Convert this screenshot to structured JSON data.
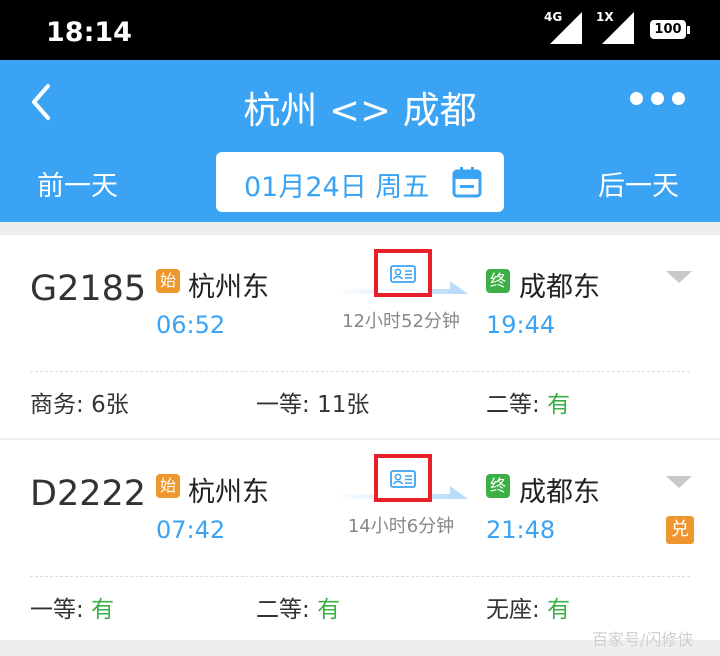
{
  "status_bar": {
    "time": "18:14",
    "network_1": "4G",
    "network_2": "1X",
    "battery": "100"
  },
  "header": {
    "title": "杭州 <> 成都",
    "prev_day": "前一天",
    "next_day": "后一天",
    "date": "01月24日 周五",
    "back_icon": "chevron-left-icon",
    "more_icon": "more-dots-icon",
    "calendar_icon": "calendar-icon"
  },
  "trains": [
    {
      "number": "G2185",
      "start_badge": "始",
      "from": "杭州东",
      "depart": "06:52",
      "duration": "12小时52分钟",
      "end_badge": "终",
      "to": "成都东",
      "arrive": "19:44",
      "seats": [
        {
          "label": "商务:",
          "value": "6张"
        },
        {
          "label": "一等:",
          "value": "11张"
        },
        {
          "label": "二等:",
          "value": "有"
        }
      ]
    },
    {
      "number": "D2222",
      "start_badge": "始",
      "from": "杭州东",
      "depart": "07:42",
      "duration": "14小时6分钟",
      "end_badge": "终",
      "to": "成都东",
      "arrive": "21:48",
      "exchange_badge": "兑",
      "seats": [
        {
          "label": "一等:",
          "value": "有"
        },
        {
          "label": "二等:",
          "value": "有"
        },
        {
          "label": "无座:",
          "value": "有"
        }
      ]
    }
  ],
  "colors": {
    "primary": "#3aa3f4",
    "available": "#3cb047",
    "start_badge": "#f0962f",
    "highlight_box": "#e8202a"
  },
  "watermark": "百家号/闪修侠"
}
